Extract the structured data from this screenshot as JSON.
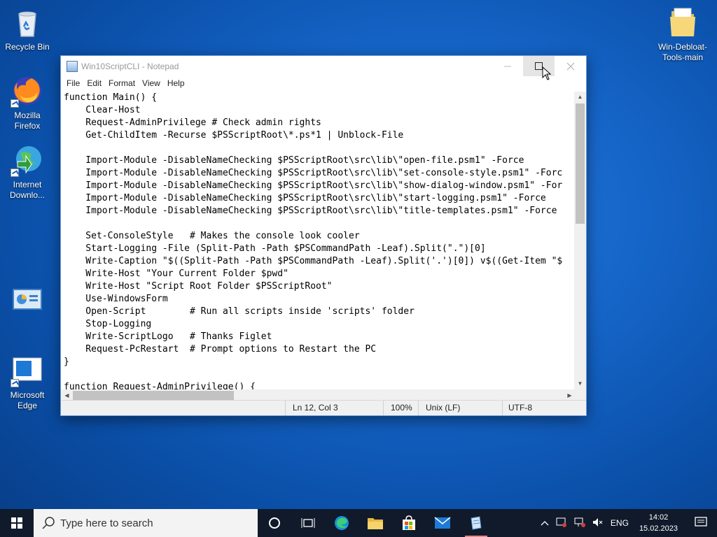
{
  "desktop": {
    "icons": [
      {
        "label": "Recycle Bin"
      },
      {
        "label": "Mozilla Firefox"
      },
      {
        "label": "Internet Downlo..."
      },
      {
        "label": ""
      },
      {
        "label": "Microsoft Edge"
      },
      {
        "label": "Win-Debloat-Tools-main"
      }
    ]
  },
  "window": {
    "title": "Win10ScriptCLI - Notepad",
    "menu": [
      "File",
      "Edit",
      "Format",
      "View",
      "Help"
    ],
    "content": "function Main() {\n    Clear-Host\n    Request-AdminPrivilege # Check admin rights\n    Get-ChildItem -Recurse $PSScriptRoot\\*.ps*1 | Unblock-File\n\n    Import-Module -DisableNameChecking $PSScriptRoot\\src\\lib\\\"open-file.psm1\" -Force\n    Import-Module -DisableNameChecking $PSScriptRoot\\src\\lib\\\"set-console-style.psm1\" -Forc\n    Import-Module -DisableNameChecking $PSScriptRoot\\src\\lib\\\"show-dialog-window.psm1\" -For\n    Import-Module -DisableNameChecking $PSScriptRoot\\src\\lib\\\"start-logging.psm1\" -Force\n    Import-Module -DisableNameChecking $PSScriptRoot\\src\\lib\\\"title-templates.psm1\" -Force\n\n    Set-ConsoleStyle   # Makes the console look cooler\n    Start-Logging -File (Split-Path -Path $PSCommandPath -Leaf).Split(\".\")[0]\n    Write-Caption \"$((Split-Path -Path $PSCommandPath -Leaf).Split('.')[0]) v$((Get-Item \"$\n    Write-Host \"Your Current Folder $pwd\"\n    Write-Host \"Script Root Folder $PSScriptRoot\"\n    Use-WindowsForm\n    Open-Script        # Run all scripts inside 'scripts' folder\n    Stop-Logging\n    Write-ScriptLogo   # Thanks Figlet\n    Request-PcRestart  # Prompt options to Restart the PC\n}\n\nfunction Request-AdminPrivilege() {",
    "status": {
      "position": "Ln 12, Col 3",
      "zoom": "100%",
      "line_ending": "Unix (LF)",
      "encoding": "UTF-8"
    }
  },
  "taskbar": {
    "search_placeholder": "Type here to search",
    "language": "ENG",
    "time": "14:02",
    "date": "15.02.2023"
  }
}
